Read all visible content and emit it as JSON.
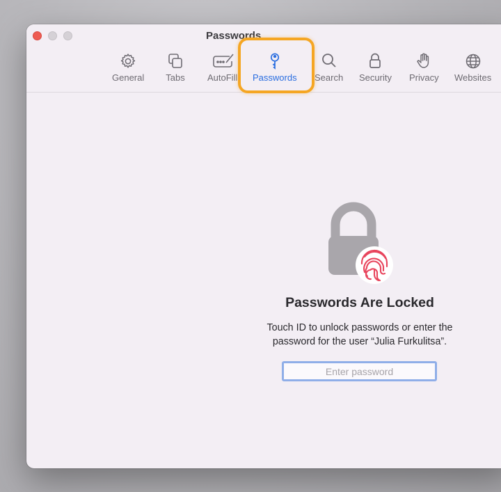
{
  "window": {
    "title": "Passwords"
  },
  "toolbar": {
    "items": [
      {
        "label": "General",
        "icon": "gear-icon"
      },
      {
        "label": "Tabs",
        "icon": "tabs-icon"
      },
      {
        "label": "AutoFill",
        "icon": "autofill-icon"
      },
      {
        "label": "Passwords",
        "icon": "key-icon",
        "active": true
      },
      {
        "label": "Search",
        "icon": "search-icon"
      },
      {
        "label": "Security",
        "icon": "lock-icon"
      },
      {
        "label": "Privacy",
        "icon": "hand-icon"
      },
      {
        "label": "Websites",
        "icon": "globe-icon"
      }
    ]
  },
  "locked": {
    "title": "Passwords Are Locked",
    "description_line1": "Touch ID to unlock passwords or enter the",
    "description_line2": "password for the user “Julia Furkulitsa”.",
    "password_placeholder": "Enter password",
    "password_value": ""
  },
  "colors": {
    "accent": "#2a6ee0",
    "highlight": "#f5a623",
    "fingerprint": "#e8445c",
    "close": "#ee5c52"
  }
}
